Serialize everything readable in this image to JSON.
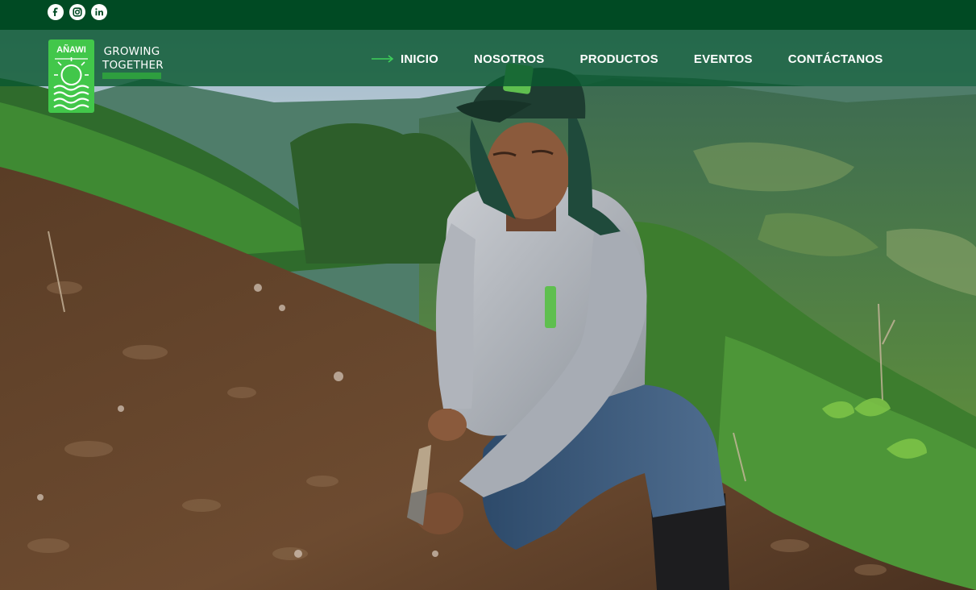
{
  "topbar": {
    "social": [
      {
        "icon": "facebook-icon"
      },
      {
        "icon": "instagram-icon"
      },
      {
        "icon": "linkedin-icon"
      }
    ]
  },
  "brand": {
    "logo_text": "AÑAWI",
    "tagline": "GROWING\nTOGETHER"
  },
  "nav": {
    "items": [
      {
        "label": "INICIO",
        "active": true
      },
      {
        "label": "NOSOTROS"
      },
      {
        "label": "PRODUCTOS"
      },
      {
        "label": "EVENTOS"
      },
      {
        "label": "CONTÁCTANOS"
      }
    ]
  },
  "hero": {
    "description": "Farmer kneeling on a hillside planting with a machete, green mountains behind"
  },
  "colors": {
    "topbar": "#004a23",
    "navbar": "#0a5830",
    "logo_green": "#42c74a",
    "accent": "#2e9e3f"
  }
}
